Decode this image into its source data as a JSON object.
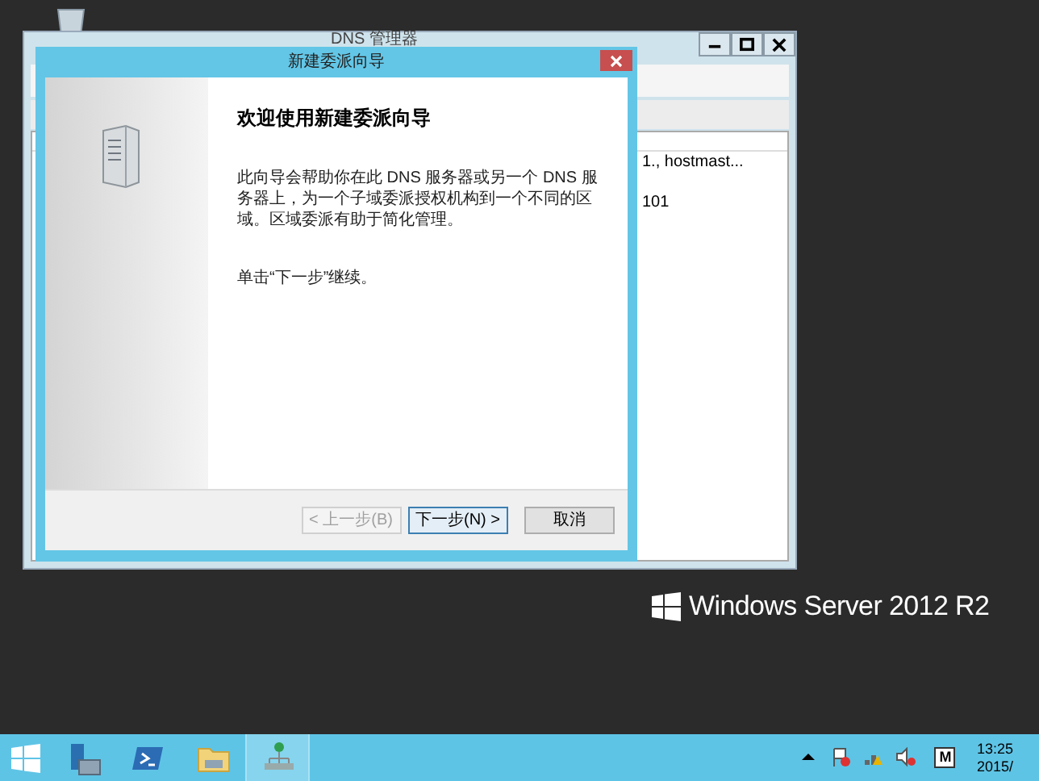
{
  "background_window": {
    "title": "DNS 管理器",
    "list_rows": [
      {
        "column_1": "1., hostmast..."
      },
      {
        "column_1": "101"
      }
    ]
  },
  "dialog": {
    "title": "新建委派向导",
    "heading": "欢迎使用新建委派向导",
    "paragraph": "此向导会帮助你在此 DNS 服务器或另一个 DNS 服务器上，为一个子域委派授权机构到一个不同的区域。区域委派有助于简化管理。",
    "instruction": "单击“下一步”继续。",
    "buttons": [
      {
        "label": "< 上一步(B)",
        "disabled": true,
        "default": false
      },
      {
        "label": "下一步(N) >",
        "disabled": false,
        "default": true
      },
      {
        "label": "取消",
        "disabled": false,
        "default": false
      }
    ]
  },
  "branding": {
    "text": "Windows Server 2012 R2"
  },
  "taskbar": {
    "apps": [
      {
        "kind": "server-manager",
        "selected": false
      },
      {
        "kind": "powershell",
        "selected": false
      },
      {
        "kind": "explorer",
        "selected": false
      },
      {
        "kind": "dns",
        "selected": true
      }
    ],
    "ime_indicator": "M",
    "clock_time": "13:25",
    "clock_date": "2015/"
  }
}
